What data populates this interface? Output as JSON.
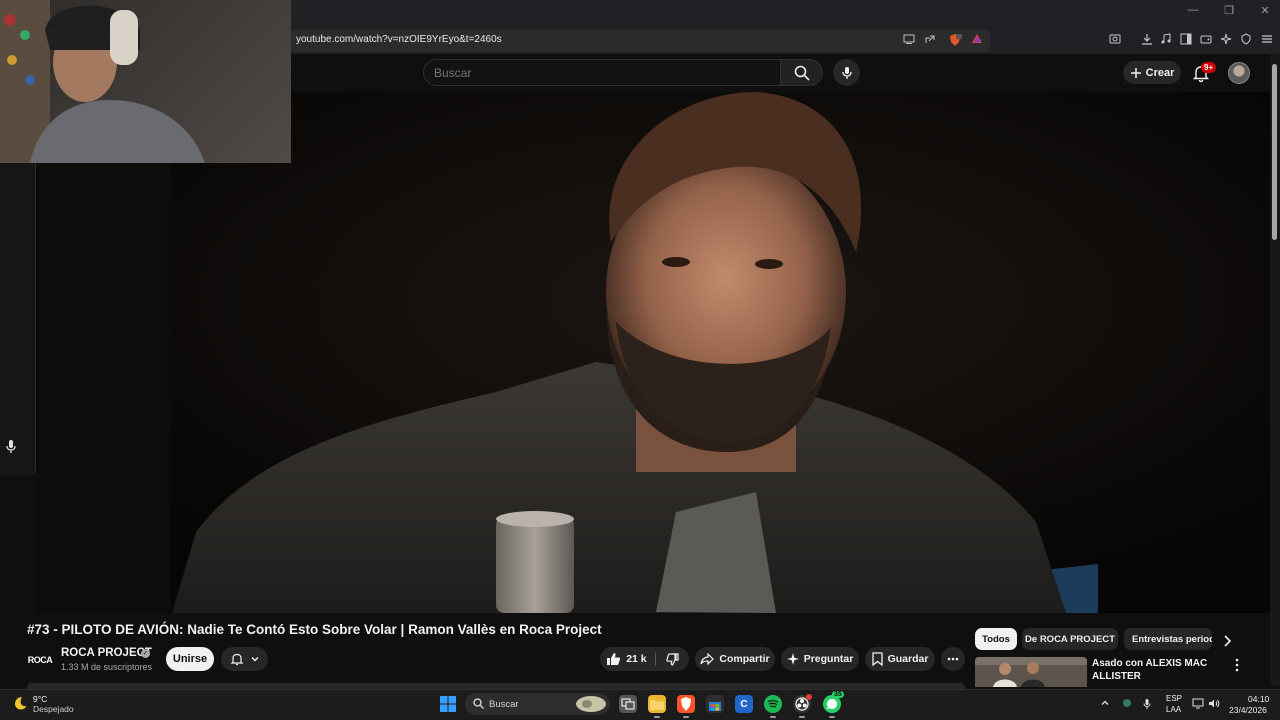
{
  "browser": {
    "url": "youtube.com/watch?v=nzOIE9YrEyo&t=2460s",
    "window_controls": [
      "—",
      "❐",
      "✕"
    ]
  },
  "header": {
    "search_placeholder": "Buscar",
    "create_label": "Crear",
    "notification_badge": "9+"
  },
  "video": {
    "title": "#73 - PILOTO DE AVIÓN: Nadie Te Contó Esto Sobre Volar | Ramon Vallès en Roca Project"
  },
  "channel": {
    "logo_text": "ROCA",
    "name": "ROCA PROJECT",
    "subscribers": "1.33 M de suscriptores",
    "join_label": "Unirse"
  },
  "actions": {
    "likes": "21 k",
    "share": "Compartir",
    "ask": "Preguntar",
    "save": "Guardar"
  },
  "recommendations": {
    "chips": [
      "Todos",
      "De ROCA PROJECT",
      "Entrevistas period"
    ],
    "items": [
      {
        "title": "Asado con ALEXIS MAC ALLISTER"
      }
    ]
  },
  "taskbar": {
    "weather_temp": "9°C",
    "weather_desc": "Despejado",
    "search_label": "Buscar",
    "whatsapp_badge": "35",
    "lang_top": "ESP",
    "lang_bottom": "LAA",
    "time": "04:10",
    "date": "23/4/2026"
  },
  "colors": {
    "background": "#0f0f0f",
    "pill": "#272727",
    "badge_red": "#cc0000",
    "text": "#f1f1f1",
    "muted": "#aaaaaa"
  }
}
